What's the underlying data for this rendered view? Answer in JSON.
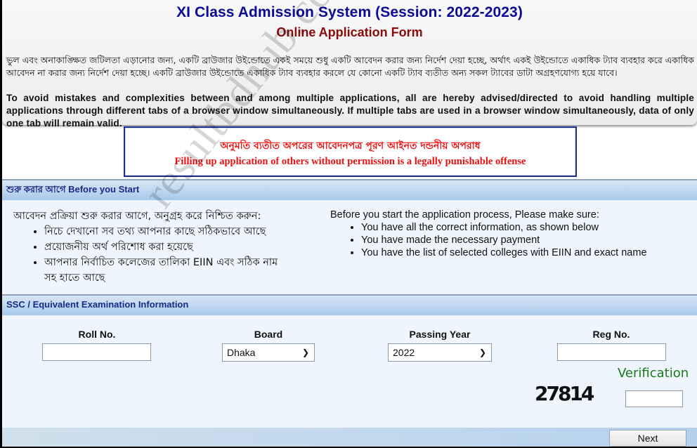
{
  "header": {
    "title": "XI Class Admission System (Session: 2022-2023)",
    "subtitle": "Online Application Form",
    "notice_bn": "ভুল এবং অনাকাঙ্ক্ষিত জটিলতা এড়ানোর জন্য, একটি ব্রাউজার উইন্ডোতে একই সময়ে শুধু একটি আবেদন করার জন্য নির্দেশ দেয়া হচ্ছে, অর্থাৎ একই উইন্ডোতে একাধিক ট্যাব ব্যবহার করে একাধিক আবেদন না করার জন্য নির্দেশ দেয়া হচ্ছে। একটি ব্রাউজার উইন্ডোতে একাধিক ট্যাব ব্যবহার করলে যে কোনো একটি ট্যাব ব্যতীত অন্য সকল ট্যাবের ডাটা অগ্রহণযোগ্য হয়ে যাবে।",
    "notice_en": "To avoid mistakes and complexities between and among multiple applications, all are hereby advised/directed to avoid handling multiple applications through different tabs of a browser window simultaneously. If multiple tabs are used in a browser window simultaneously, data of only one tab will remain valid."
  },
  "warning": {
    "bn": "অনুমতি ব্যতীত অপরের আবেদনপত্র পূরণ আইনত দন্ডনীয় অপরাধ",
    "en": "Filling up application of others without permission is a legally punishable offense",
    "color": "#ee1111"
  },
  "before_start": {
    "heading": "শুরু করার আগে Before you Start",
    "bn_intro": "আবেদন প্রক্রিয়া শুরু করার আগে, অনুগ্রহ করে নিশ্চিত করুন:",
    "bn_items": [
      "নিচে দেখানো সব তথ্য আপনার কাছে সঠিকভাবে আছে",
      "প্রয়োজনীয় অর্থ পরিশোধ করা হয়েছে",
      "আপনার নির্বাচিত কলেজের তালিকা EIIN এবং সঠিক নাম সহ হাতে আছে"
    ],
    "en_intro": "Before you start the application process, Please make sure:",
    "en_items": [
      "You have all the correct information, as shown below",
      "You have made the necessary payment",
      "You have the list of selected colleges with EIIN and exact name"
    ]
  },
  "ssc": {
    "heading": "SSC / Equivalent Examination Information",
    "roll_label": "Roll No.",
    "roll_value": "",
    "board_label": "Board",
    "board_value": "Dhaka",
    "year_label": "Passing Year",
    "year_value": "2022",
    "reg_label": "Reg No.",
    "reg_value": "",
    "verification_label": "Verification",
    "captcha": "27814",
    "verification_value": ""
  },
  "actions": {
    "next_label": "Next"
  },
  "watermark": "resultbdhub.com",
  "colors": {
    "title": "#0a0a96",
    "subtitle": "#8b0a0a",
    "section_heading": "#1a2a88",
    "verification": "#1a7a1a"
  }
}
